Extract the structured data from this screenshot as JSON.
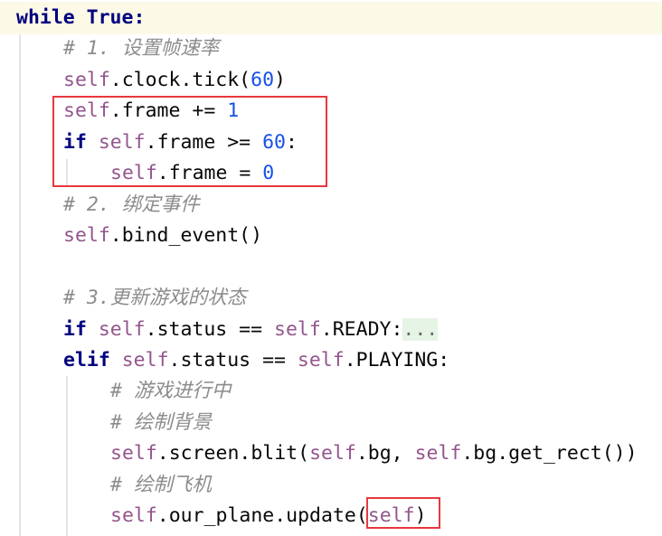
{
  "editor": {
    "colors": {
      "keyword": "#000080",
      "self": "#94558d",
      "number": "#1750eb",
      "comment": "#8c8c8c",
      "highlight_box": "#e8383d",
      "current_line": "#fcfae6"
    },
    "lines": [
      {
        "indent": 0,
        "tokens": [
          {
            "t": "while True:",
            "c": "kw"
          }
        ]
      },
      {
        "indent": 1,
        "tokens": [
          {
            "t": "# 1. 设置帧速率",
            "c": "cm"
          }
        ]
      },
      {
        "indent": 1,
        "tokens": [
          {
            "t": "self",
            "c": "self"
          },
          {
            "t": ".clock.tick("
          },
          {
            "t": "60",
            "c": "num"
          },
          {
            "t": ")"
          }
        ]
      },
      {
        "indent": 1,
        "tokens": [
          {
            "t": "self",
            "c": "self"
          },
          {
            "t": ".frame += "
          },
          {
            "t": "1",
            "c": "num"
          }
        ]
      },
      {
        "indent": 1,
        "tokens": [
          {
            "t": "if",
            "c": "kw"
          },
          {
            "t": " "
          },
          {
            "t": "self",
            "c": "self"
          },
          {
            "t": ".frame >= "
          },
          {
            "t": "60",
            "c": "num"
          },
          {
            "t": ":"
          }
        ]
      },
      {
        "indent": 2,
        "tokens": [
          {
            "t": "self",
            "c": "self"
          },
          {
            "t": ".frame = "
          },
          {
            "t": "0",
            "c": "num"
          }
        ]
      },
      {
        "indent": 1,
        "tokens": [
          {
            "t": "# 2. 绑定事件",
            "c": "cm"
          }
        ]
      },
      {
        "indent": 1,
        "tokens": [
          {
            "t": "self",
            "c": "self"
          },
          {
            "t": ".bind_event()"
          }
        ]
      },
      {
        "indent": 0,
        "tokens": []
      },
      {
        "indent": 1,
        "tokens": [
          {
            "t": "# 3.更新游戏的状态",
            "c": "cm"
          }
        ]
      },
      {
        "indent": 1,
        "tokens": [
          {
            "t": "if",
            "c": "kw"
          },
          {
            "t": " "
          },
          {
            "t": "self",
            "c": "self"
          },
          {
            "t": ".status == "
          },
          {
            "t": "self",
            "c": "self"
          },
          {
            "t": ".READY:"
          },
          {
            "t": "...",
            "c": "fold"
          }
        ]
      },
      {
        "indent": 1,
        "tokens": [
          {
            "t": "elif",
            "c": "kw"
          },
          {
            "t": " "
          },
          {
            "t": "self",
            "c": "self"
          },
          {
            "t": ".status == "
          },
          {
            "t": "self",
            "c": "self"
          },
          {
            "t": ".PLAYING:"
          }
        ]
      },
      {
        "indent": 2,
        "tokens": [
          {
            "t": "# 游戏进行中",
            "c": "cm"
          }
        ]
      },
      {
        "indent": 2,
        "tokens": [
          {
            "t": "# 绘制背景",
            "c": "cm"
          }
        ]
      },
      {
        "indent": 2,
        "tokens": [
          {
            "t": "self",
            "c": "self"
          },
          {
            "t": ".screen.blit("
          },
          {
            "t": "self",
            "c": "self"
          },
          {
            "t": ".bg, "
          },
          {
            "t": "self",
            "c": "self"
          },
          {
            "t": ".bg.get_rect())"
          }
        ]
      },
      {
        "indent": 2,
        "tokens": [
          {
            "t": "# 绘制飞机",
            "c": "cm"
          }
        ]
      },
      {
        "indent": 2,
        "tokens": [
          {
            "t": "self",
            "c": "self"
          },
          {
            "t": ".our_plane.update("
          },
          {
            "t": "self",
            "c": "self"
          },
          {
            "t": ")"
          }
        ]
      }
    ]
  }
}
